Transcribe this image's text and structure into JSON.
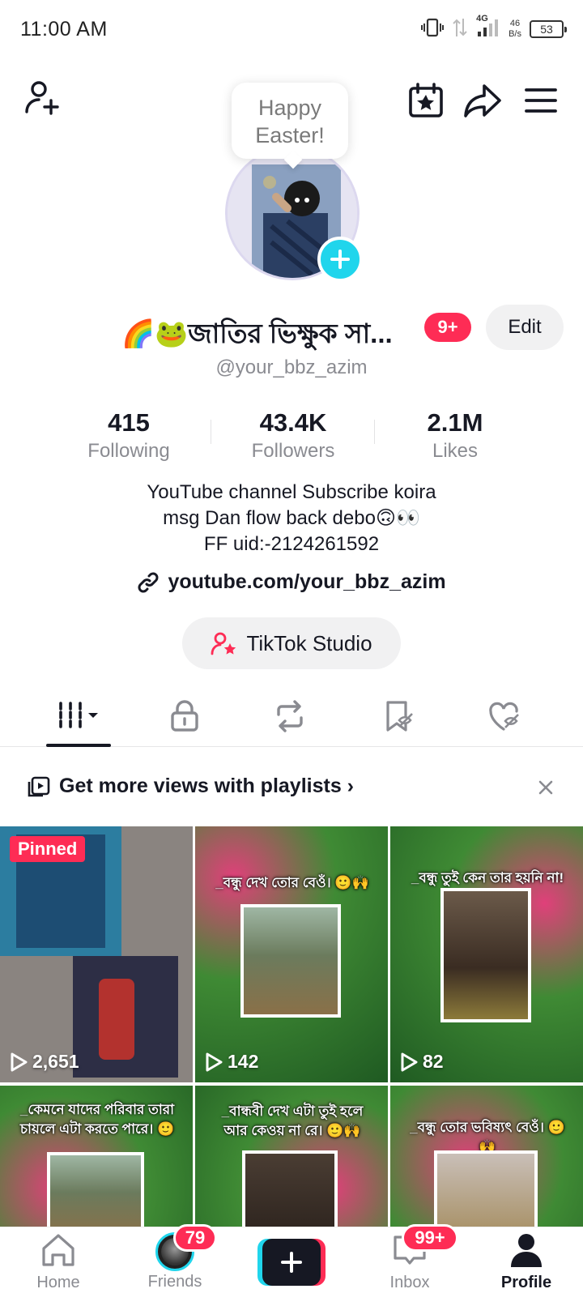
{
  "status_bar": {
    "time": "11:00 AM",
    "network": "4G",
    "speed_value": "46",
    "speed_unit": "B/s",
    "battery": "53"
  },
  "header": {
    "add_friend_icon": "person-add-icon",
    "calendar_icon": "calendar-star-icon",
    "share_icon": "share-arrow-icon",
    "menu_icon": "hamburger-menu-icon"
  },
  "tooltip": {
    "line1": "Happy",
    "line2": "Easter!"
  },
  "profile": {
    "display_name": "🌈🐸জাতির ভিক্ষুক সা...",
    "name_badge": "9+",
    "edit_label": "Edit",
    "handle": "@your_bbz_azim"
  },
  "stats": [
    {
      "value": "415",
      "label": "Following"
    },
    {
      "value": "43.4K",
      "label": "Followers"
    },
    {
      "value": "2.1M",
      "label": "Likes"
    }
  ],
  "bio": {
    "lines": [
      "YouTube channel Subscribe koira",
      "msg Dan flow back debo🙃👀",
      "FF uid:-2124261592"
    ],
    "link": "youtube.com/your_bbz_azim"
  },
  "studio": {
    "label": "TikTok Studio"
  },
  "tabs": [
    {
      "name": "videos",
      "icon": "grid-bars-icon",
      "active": true
    },
    {
      "name": "private",
      "icon": "lock-icon",
      "active": false
    },
    {
      "name": "reposts",
      "icon": "repost-icon",
      "active": false
    },
    {
      "name": "favorites",
      "icon": "bookmark-hidden-icon",
      "active": false
    },
    {
      "name": "liked",
      "icon": "heart-hidden-icon",
      "active": false
    }
  ],
  "playlist_banner": {
    "text": "Get more views with playlists ›"
  },
  "videos": [
    {
      "views": "2,651",
      "pinned_label": "Pinned",
      "caption": ""
    },
    {
      "views": "142",
      "caption": "_বন্ধু দেখ তোর বেওঁ। 🙂🙌"
    },
    {
      "views": "82",
      "caption": "_বন্ধু তুই কেন তার হয়নি না!😥"
    },
    {
      "views": "",
      "caption": "_কেমনে যাদের পরিবার তারা চায়লে এটা করতে পারে। 🙂"
    },
    {
      "views": "",
      "caption": "_বান্ধবী দেখ এটা তুই হলে আর কেওয় না রে। 🙂🙌"
    },
    {
      "views": "",
      "caption": "_বন্ধু তোর ভবিষ্যৎ বেওঁ। 🙂🙌"
    }
  ],
  "bottom_nav": {
    "home": "Home",
    "friends": "Friends",
    "friends_badge": "79",
    "inbox": "Inbox",
    "inbox_badge": "99+",
    "profile": "Profile"
  },
  "colors": {
    "accent": "#fe2c55",
    "cyan": "#20d5ec",
    "text_primary": "#161823",
    "text_secondary": "#8a8b91"
  }
}
